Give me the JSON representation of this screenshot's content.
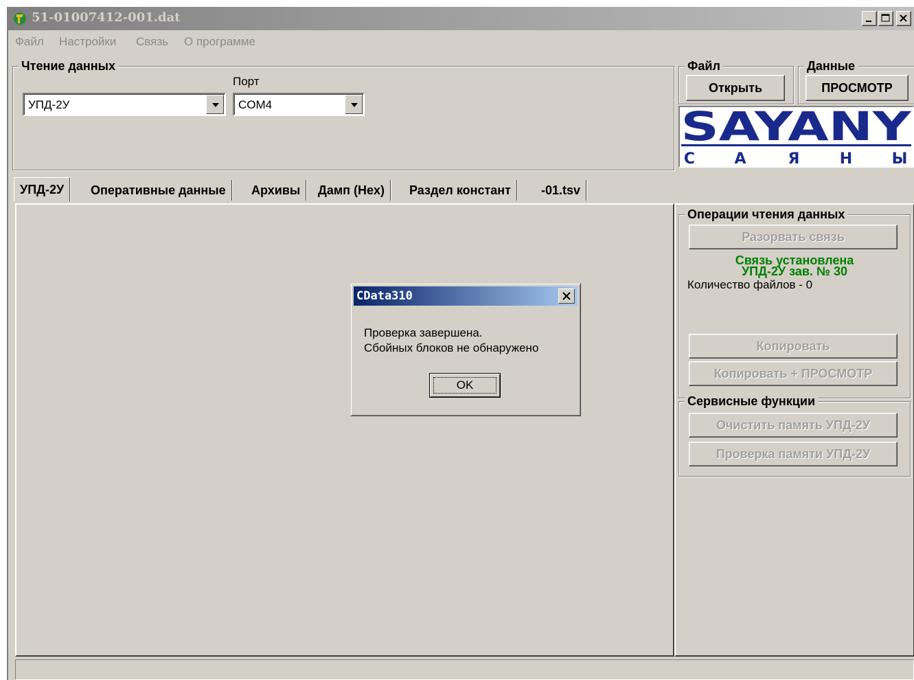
{
  "window": {
    "title": "51-01007412-001.dat"
  },
  "menu": {
    "items": [
      "Файл",
      "Настройки",
      "Связь",
      "О программе"
    ]
  },
  "read_group": {
    "title": "Чтение данных",
    "device_value": "УПД-2У",
    "port_label": "Порт",
    "port_value": "COM4"
  },
  "file_group": {
    "title": "Файл",
    "open_label": "Открыть"
  },
  "data_group": {
    "title": "Данные",
    "view_label": "ПРОСМОТР"
  },
  "logo": {
    "latin": "SAYANY",
    "cyrillic": [
      "С",
      "А",
      "Я",
      "Н",
      "Ы"
    ]
  },
  "tabs": [
    "УПД-2У",
    "Оперативные данные",
    "Архивы",
    "Дамп (Hex)",
    "Раздел констант",
    "-01.tsv"
  ],
  "operations": {
    "title": "Операции чтения данных",
    "disconnect_label": "Разорвать связь",
    "status_line1": "Связь установлена",
    "status_line2": "УПД-2У зав. № 30",
    "files_count": "Количество файлов - 0",
    "copy_label": "Копировать",
    "copy_view_label": "Копировать + ПРОСМОТР"
  },
  "service": {
    "title": "Сервисные функции",
    "clear_label": "Очистить память УПД-2У",
    "check_label": "Проверка памяти УПД-2У"
  },
  "dialog": {
    "title": "CData310",
    "line1": "Проверка завершена.",
    "line2": "Сбойных блоков не обнаружено",
    "ok_label": "OK"
  },
  "colors": {
    "face": "#d4d0c8",
    "logo_blue": "#1a2a8c",
    "status_green": "#008000",
    "dialog_title": "#0a246a"
  }
}
